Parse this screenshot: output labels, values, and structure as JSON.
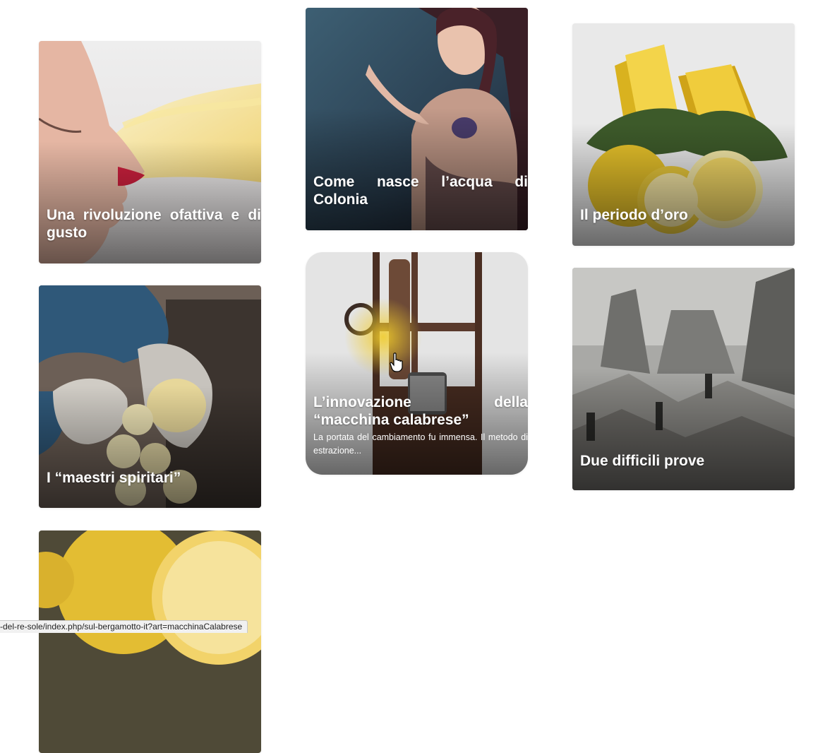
{
  "cards": [
    {
      "title": "Una rivoluzione ofattiva e di gusto"
    },
    {
      "title": "Come nasce l’acqua di Colonia"
    },
    {
      "title": "Il periodo d’oro"
    },
    {
      "title": "I “maestri spiritari”"
    },
    {
      "title": "L’innovazione della “macchina calabrese”",
      "excerpt": "La portata del cambiamento fu immensa. Il metodo di estrazione..."
    },
    {
      "title": "Due difficili prove"
    },
    {
      "title": ""
    }
  ],
  "status_bar": {
    "url": "-del-re-sole/index.php/sul-bergamotto-it?art=macchinaCalabrese"
  },
  "colors": {
    "background": "#ffffff",
    "caption_text": "#ffffff",
    "accent_yellow": "#e8c322"
  }
}
